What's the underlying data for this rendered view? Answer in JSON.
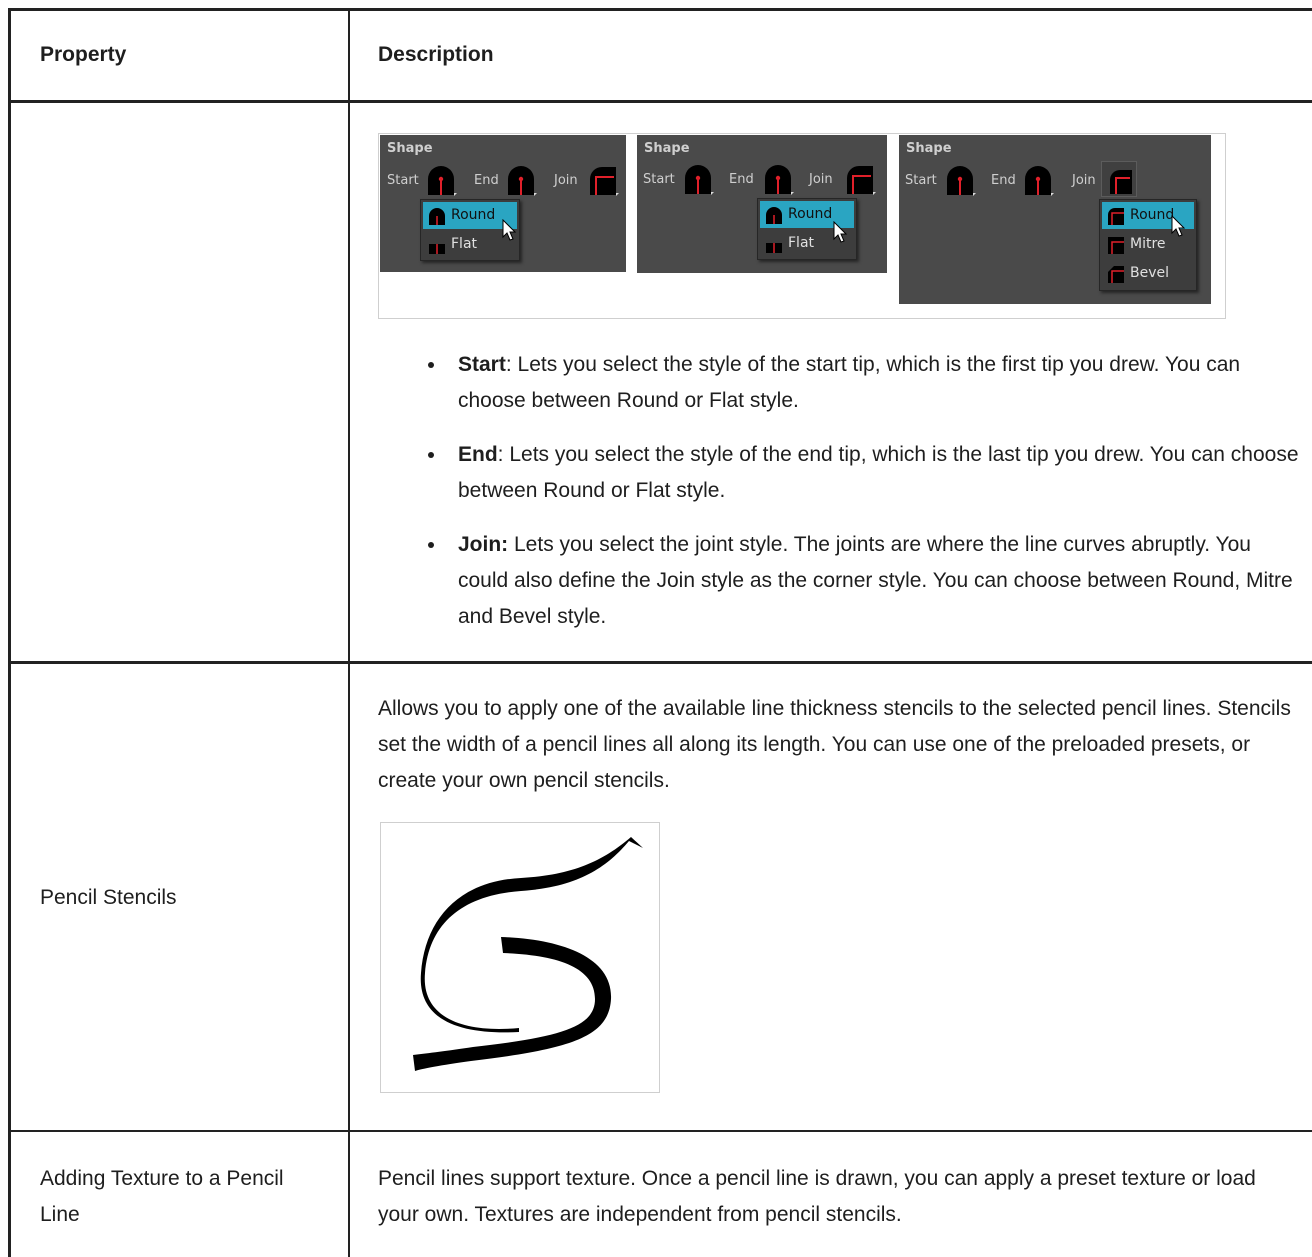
{
  "table": {
    "headers": {
      "property": "Property",
      "description": "Description"
    },
    "shape_row": {
      "panels": [
        {
          "title": "Shape",
          "start": "Start",
          "end": "End",
          "join": "Join",
          "menu": [
            "Round",
            "Flat"
          ],
          "selected": "Round"
        },
        {
          "title": "Shape",
          "start": "Start",
          "end": "End",
          "join": "Join",
          "menu": [
            "Round",
            "Flat"
          ],
          "selected": "Round"
        },
        {
          "title": "Shape",
          "start": "Start",
          "end": "End",
          "join": "Join",
          "menu": [
            "Round",
            "Mitre",
            "Bevel"
          ],
          "selected": "Round"
        }
      ],
      "bullets": [
        {
          "term": "Start",
          "text": ": Lets you select the style of the start tip, which is the first tip you drew. You can choose between Round or Flat style."
        },
        {
          "term": "End",
          "text": ": Lets you select the style of the end tip, which is the last tip you drew. You can choose between Round or Flat style."
        },
        {
          "term": "Join:",
          "text": " Lets you select the joint style. The joints are where the line curves abruptly. You could also define the Join style as the corner style. You can choose between Round, Mitre and Bevel style."
        }
      ]
    },
    "stencils_row": {
      "property": "Pencil Stencils",
      "description": "Allows you to apply one of the available line thickness stencils to the selected pencil lines. Stencils set the width of a pencil lines all along its length. You can use one of the preloaded presets, or create your own pencil stencils."
    },
    "texture_row": {
      "property": "Adding Texture to a Pencil Line",
      "description": "Pencil lines support texture. Once a pencil line is drawn, you can apply a preset texture or load your own. Textures are independent from pencil stencils."
    }
  },
  "colors": {
    "panel_bg": "#4a4a4a",
    "menu_highlight": "#2aa5c2",
    "tip_red": "#e0202a",
    "border": "#222222"
  }
}
